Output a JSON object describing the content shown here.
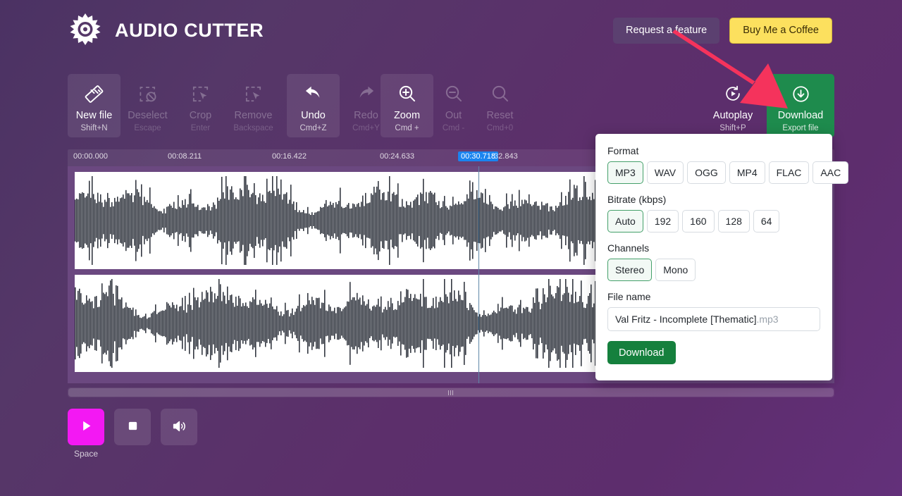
{
  "app": {
    "title": "AUDIO CUTTER",
    "logo_icon": "gear-audio-icon"
  },
  "header": {
    "request_feature_label": "Request a feature",
    "buy_coffee_label": "Buy Me a Coffee",
    "coffee_color": "#fce05e"
  },
  "toolbar": {
    "items": [
      {
        "label": "New file",
        "key": "Shift+N",
        "icon": "ruler-icon",
        "state": "active"
      },
      {
        "label": "Deselect",
        "key": "Escape",
        "icon": "deselect-icon",
        "state": "disabled"
      },
      {
        "label": "Crop",
        "key": "Enter",
        "icon": "crop-icon",
        "state": "disabled"
      },
      {
        "label": "Remove",
        "key": "Backspace",
        "icon": "remove-icon",
        "state": "disabled"
      },
      {
        "label": "Undo",
        "key": "Cmd+Z",
        "icon": "undo-arrow-icon",
        "state": "active"
      },
      {
        "label": "Redo",
        "key": "Cmd+Y",
        "icon": "redo-arrow-icon",
        "state": "disabled"
      },
      {
        "label": "Zoom",
        "key": "Cmd +",
        "icon": "zoom-in-icon",
        "state": "active"
      },
      {
        "label": "Out",
        "key": "Cmd -",
        "icon": "zoom-out-icon",
        "state": "disabled"
      },
      {
        "label": "Reset",
        "key": "Cmd+0",
        "icon": "magnifier-icon",
        "state": "disabled"
      }
    ],
    "right_items": [
      {
        "label": "Autoplay",
        "key": "Shift+P",
        "icon": "autoplay-icon",
        "state": "normal"
      },
      {
        "label": "Download",
        "key": "Export file",
        "icon": "download-circle-icon",
        "state": "primary"
      }
    ],
    "download_color": "#1e8b4d"
  },
  "timeline": {
    "ticks": [
      {
        "time": "00:00.000",
        "highlighted": false
      },
      {
        "time": "00:08.211",
        "highlighted": false
      },
      {
        "time": "00:16.422",
        "highlighted": false
      },
      {
        "time": "00:24.633",
        "highlighted": false
      },
      {
        "time": "00:30.718",
        "highlighted": true
      },
      {
        "time": ":32.843",
        "highlighted": false
      }
    ],
    "playhead_time": "00:30.718",
    "playhead_color": "#1a84f0",
    "channels": 2
  },
  "transport": {
    "play_label": "play-button",
    "play_key": "Space",
    "stop_label": "stop-button",
    "volume_label": "volume-button",
    "play_color": "#f318f3"
  },
  "export_panel": {
    "format_label": "Format",
    "formats": [
      "MP3",
      "WAV",
      "OGG",
      "MP4",
      "FLAC",
      "AAC"
    ],
    "format_selected": "MP3",
    "bitrate_label": "Bitrate (kbps)",
    "bitrates": [
      "Auto",
      "192",
      "160",
      "128",
      "64"
    ],
    "bitrate_selected": "Auto",
    "channels_label": "Channels",
    "channel_options": [
      "Stereo",
      "Mono"
    ],
    "channel_selected": "Stereo",
    "filename_label": "File name",
    "filename_value": "Val Fritz - Incomplete [Thematic]",
    "filename_ext": ".mp3",
    "download_button_label": "Download",
    "accent_color": "#15803d"
  },
  "annotation": {
    "arrow_color": "#f5335c",
    "points_to": "Download"
  }
}
